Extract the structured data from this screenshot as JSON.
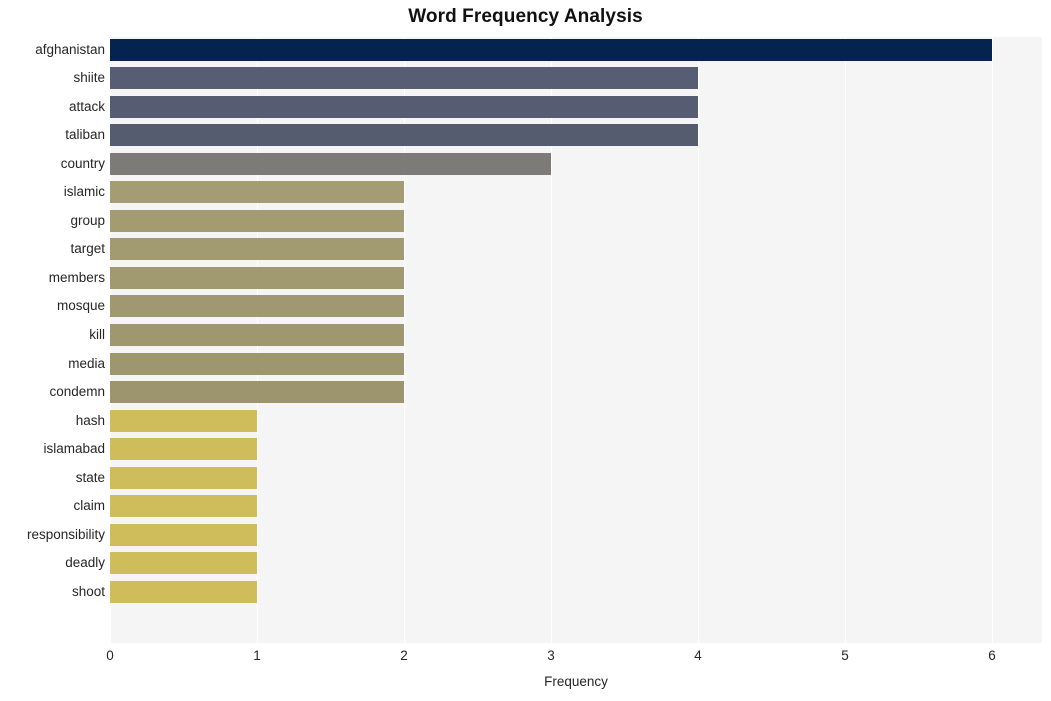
{
  "chart_data": {
    "type": "bar",
    "orientation": "horizontal",
    "title": "Word Frequency Analysis",
    "xlabel": "Frequency",
    "ylabel": "",
    "xlim": [
      0,
      6
    ],
    "xticks": [
      0,
      1,
      2,
      3,
      4,
      5,
      6
    ],
    "xtick_labels": [
      "0",
      "1",
      "2",
      "3",
      "4",
      "5",
      "6"
    ],
    "grid": true,
    "grid_axis": "x",
    "grid_color": "#ffffff",
    "plot_background": "#f5f5f5",
    "legend": null,
    "categories": [
      "afghanistan",
      "shiite",
      "attack",
      "taliban",
      "country",
      "islamic",
      "group",
      "target",
      "members",
      "mosque",
      "kill",
      "media",
      "condemn",
      "hash",
      "islamabad",
      "state",
      "claim",
      "responsibility",
      "deadly",
      "shoot"
    ],
    "values": [
      6,
      4,
      4,
      4,
      3,
      2,
      2,
      2,
      2,
      2,
      2,
      2,
      2,
      1,
      1,
      1,
      1,
      1,
      1,
      1
    ],
    "bar_colors": [
      "#04234f",
      "#575d72",
      "#565c71",
      "#565c70",
      "#7c7b77",
      "#a49c72",
      "#a39b71",
      "#a29a71",
      "#a19970",
      "#a09870",
      "#9f976f",
      "#9e966f",
      "#9d956e",
      "#cfbc5b",
      "#cfbc5b",
      "#cfbc5b",
      "#cfbc5b",
      "#cfbc5b",
      "#cfbc5b",
      "#cfbc5b"
    ]
  }
}
